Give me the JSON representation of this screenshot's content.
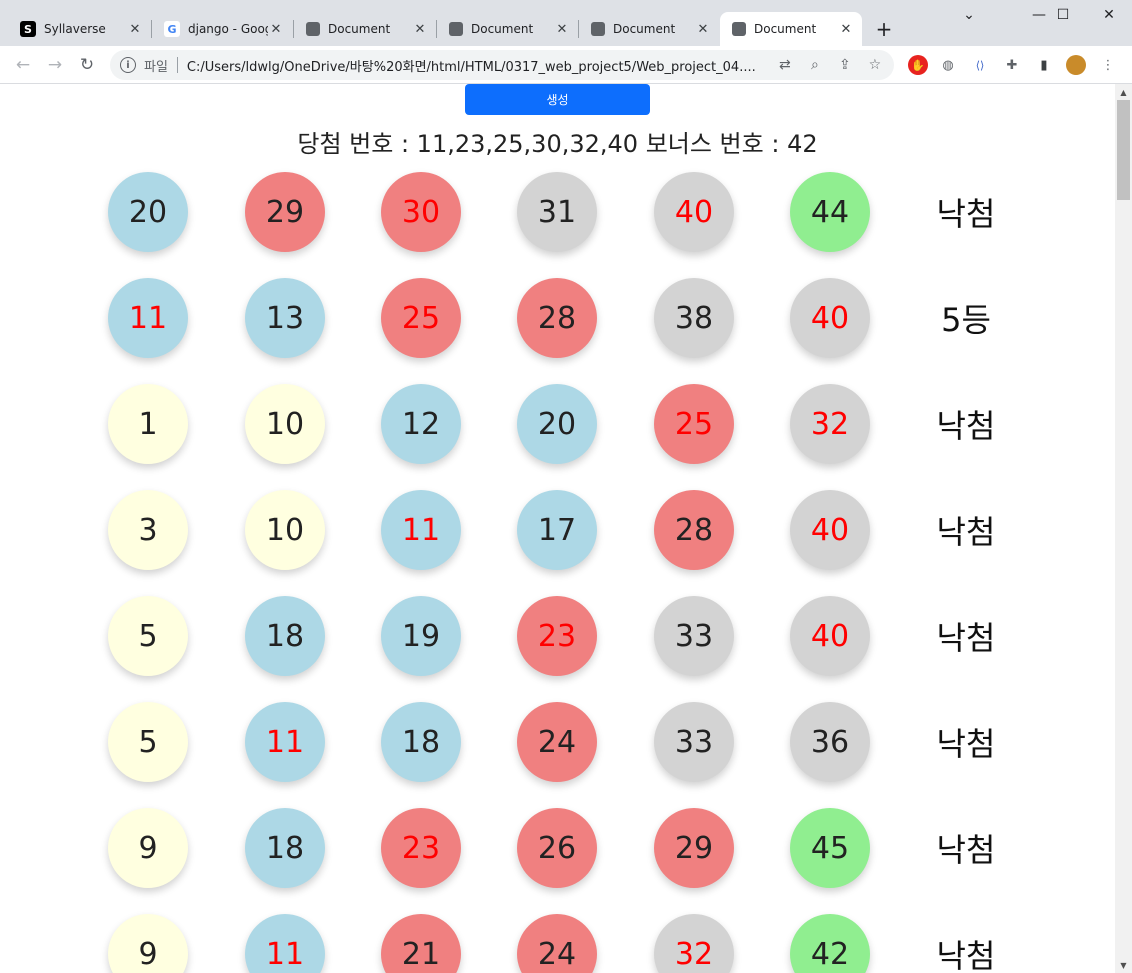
{
  "browser": {
    "tabs": [
      {
        "title": "Syllaverse",
        "favicon": "S"
      },
      {
        "title": "django - Goog",
        "favicon": "G"
      },
      {
        "title": "Document",
        "favicon": "globe-icon"
      },
      {
        "title": "Document",
        "favicon": "globe-icon"
      },
      {
        "title": "Document",
        "favicon": "globe-icon"
      },
      {
        "title": "Document",
        "favicon": "globe-icon",
        "active": true
      }
    ],
    "new_tab": "+",
    "window_controls": {
      "minimize": "—",
      "maximize": "☐",
      "close": "✕"
    },
    "address": {
      "scheme_label": "파일",
      "url": "C:/Users/ldwlg/OneDrive/바탕%20화면/html/HTML/0317_web_project5/Web_project_04...."
    }
  },
  "page": {
    "generate_button": "생성",
    "winning_text": "당첨 번호 : 11,23,25,30,32,40 보너스 번호 : 42",
    "winning_numbers": [
      11,
      23,
      25,
      30,
      32,
      40
    ],
    "bonus_number": 42,
    "rows": [
      {
        "numbers": [
          20,
          29,
          30,
          31,
          40,
          44
        ],
        "result": "낙첨"
      },
      {
        "numbers": [
          11,
          13,
          25,
          28,
          38,
          40
        ],
        "result": "5등"
      },
      {
        "numbers": [
          1,
          10,
          12,
          20,
          25,
          32
        ],
        "result": "낙첨"
      },
      {
        "numbers": [
          3,
          10,
          11,
          17,
          28,
          40
        ],
        "result": "낙첨"
      },
      {
        "numbers": [
          5,
          18,
          19,
          23,
          33,
          40
        ],
        "result": "낙첨"
      },
      {
        "numbers": [
          5,
          11,
          18,
          24,
          33,
          36
        ],
        "result": "낙첨"
      },
      {
        "numbers": [
          9,
          18,
          23,
          26,
          29,
          45
        ],
        "result": "낙첨"
      },
      {
        "numbers": [
          9,
          11,
          21,
          24,
          32,
          42
        ],
        "result": "낙첨"
      }
    ],
    "ball_colors": {
      "1-10": "#ffffe0",
      "11-20": "#add8e6",
      "21-30": "#f08080",
      "31-40": "#d3d3d3",
      "41-45": "#90ee90"
    },
    "matched_text_color": "#ff0000"
  }
}
